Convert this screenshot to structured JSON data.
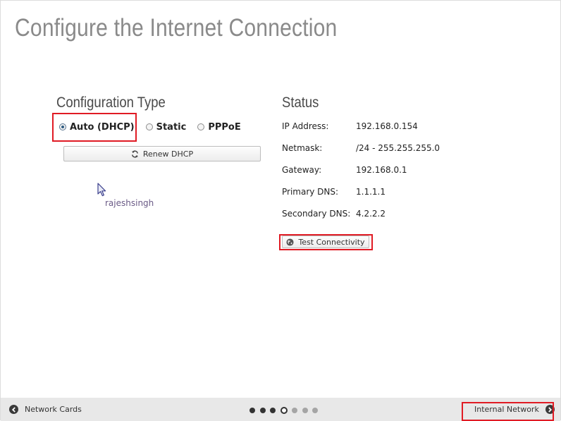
{
  "page": {
    "title": "Configure the Internet Connection"
  },
  "config": {
    "title": "Configuration Type",
    "options": [
      {
        "label": "Auto (DHCP)",
        "checked": true
      },
      {
        "label": "Static",
        "checked": false
      },
      {
        "label": "PPPoE",
        "checked": false
      }
    ],
    "renew_button": {
      "label": "Renew DHCP",
      "icon": "refresh-icon"
    }
  },
  "watermark": "rajeshsingh",
  "status": {
    "title": "Status",
    "rows": [
      {
        "label": "IP Address:",
        "value": "192.168.0.154"
      },
      {
        "label": "Netmask:",
        "value": "/24 - 255.255.255.0"
      },
      {
        "label": "Gateway:",
        "value": "192.168.0.1"
      },
      {
        "label": "Primary DNS:",
        "value": "1.1.1.1"
      },
      {
        "label": "Secondary DNS:",
        "value": "4.2.2.2"
      }
    ],
    "test_button": {
      "label": "Test Connectivity",
      "icon": "globe-icon"
    }
  },
  "footer": {
    "prev": {
      "label": "Network Cards",
      "icon": "chevron-left-circle-icon"
    },
    "next": {
      "label": "Internal Network",
      "icon": "chevron-right-circle-icon"
    },
    "progress": {
      "total_steps": 7,
      "current_step": 4
    }
  },
  "colors": {
    "highlight": "#e01b24",
    "title_gray": "#8a8a8a",
    "footer_bg": "#e8e8e8"
  }
}
